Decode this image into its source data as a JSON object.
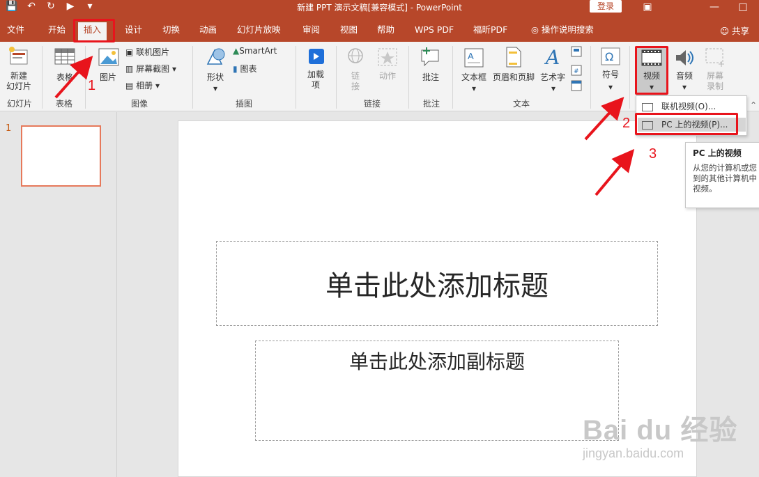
{
  "window": {
    "title": "新建 PPT 演示文稿[兼容模式] - PowerPoint",
    "login_label": "登录",
    "share_label": "共享"
  },
  "tabs": [
    "文件",
    "开始",
    "插入",
    "设计",
    "切换",
    "动画",
    "幻灯片放映",
    "审阅",
    "视图",
    "帮助",
    "WPS PDF",
    "福昕PDF",
    "操作说明搜索"
  ],
  "active_tab": "插入",
  "ribbon": {
    "new_slide": "新建\n幻灯片",
    "group_slides": "幻灯片",
    "table": "表格",
    "group_table": "表格",
    "picture": "图片",
    "online_picture": "联机图片",
    "screenshot": "屏幕截图",
    "album": "相册",
    "group_image": "图像",
    "shapes": "形状",
    "smartart": "SmartArt",
    "chart": "图表",
    "group_illustrations": "插图",
    "addins": "加载\n项",
    "link": "链\n接",
    "action": "动作",
    "group_links": "链接",
    "comment": "批注",
    "group_comments": "批注",
    "textbox": "文本框",
    "header_footer": "页眉和页脚",
    "wordart": "艺术字",
    "group_text": "文本",
    "symbols": "符号",
    "video": "视频",
    "audio": "音频",
    "screen_recording": "屏幕\n录制"
  },
  "dropdown": {
    "online_video": "联机视频(O)...",
    "pc_video": "PC 上的视频(P)..."
  },
  "tooltip": {
    "title": "PC 上的视频",
    "line1": "从您的计算机或您",
    "line2": "到的其他计算机中",
    "line3": "视频。"
  },
  "slides_panel": {
    "slide_number": "1"
  },
  "slide": {
    "title_placeholder": "单击此处添加标题",
    "subtitle_placeholder": "单击此处添加副标题"
  },
  "annotations": {
    "step1": "1",
    "step2": "2",
    "step3": "3"
  },
  "watermark": {
    "main": "Bai du 经验",
    "url": "jingyan.baidu.com"
  },
  "colors": {
    "accent": "#b7472a",
    "annotation": "#e8141c"
  }
}
